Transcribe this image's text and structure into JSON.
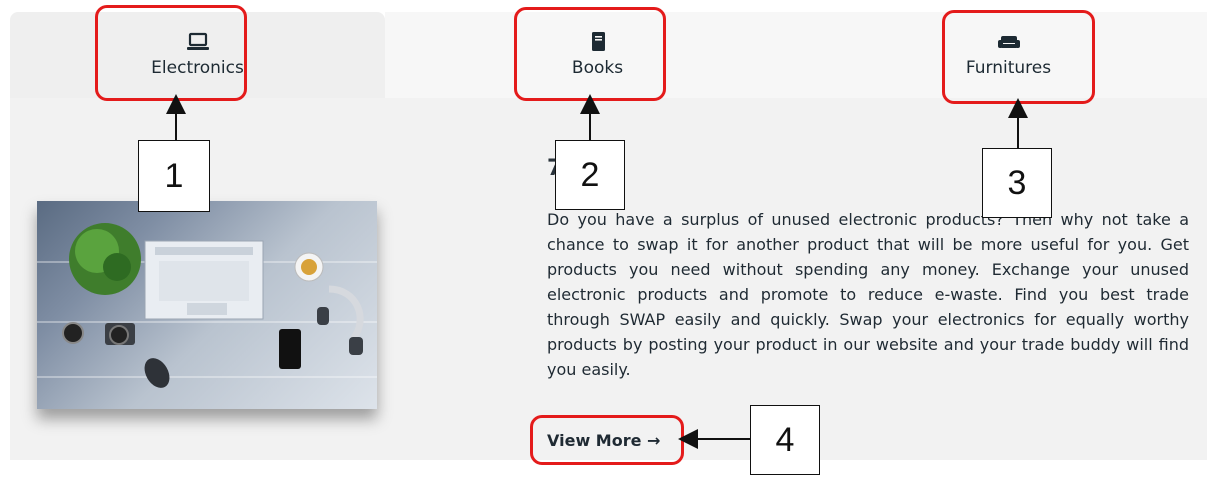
{
  "tabs": [
    {
      "label": "Electronics",
      "icon": "laptop-icon"
    },
    {
      "label": "Books",
      "icon": "book-icon"
    },
    {
      "label": "Furnitures",
      "icon": "sofa-icon"
    }
  ],
  "content": {
    "heading_fragment": "7",
    "body": "Do you have a surplus of unused electronic products? Then why not take a chance to swap it for another product that will be more useful for you. Get products you need without spending any money. Exchange your unused electronic products and promote to reduce e-waste. Find you best trade through SWAP easily and quickly. Swap your electronics for equally worthy products by posting your product in our website and your trade buddy will find you easily.",
    "view_more": "View More →"
  },
  "annotations": {
    "callout_1": "1",
    "callout_2": "2",
    "callout_3": "3",
    "callout_4": "4"
  },
  "colors": {
    "highlight": "#e41b1b",
    "panel": "#f2f2f2",
    "text": "#1f2a33"
  }
}
